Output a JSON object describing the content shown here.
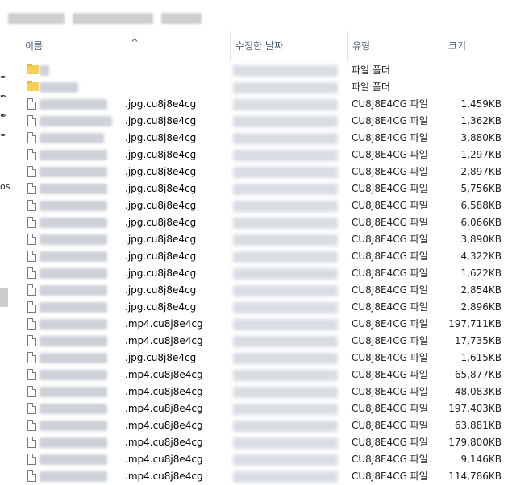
{
  "header": {
    "col_name": "이름",
    "col_date": "수정한 날짜",
    "col_type": "유형",
    "col_size": "크기",
    "sort_arrow": "^"
  },
  "nav": {
    "partial_label": "os"
  },
  "rows": [
    {
      "kind": "folder",
      "ext": "",
      "type": "파일 폴더",
      "size": ""
    },
    {
      "kind": "folder",
      "ext": "",
      "type": "파일 폴더",
      "size": ""
    },
    {
      "kind": "file",
      "ext": ".jpg.cu8j8e4cg",
      "type": "CU8J8E4CG 파일",
      "size": "1,459KB"
    },
    {
      "kind": "file",
      "ext": ".jpg.cu8j8e4cg",
      "type": "CU8J8E4CG 파일",
      "size": "1,362KB"
    },
    {
      "kind": "file",
      "ext": ".jpg.cu8j8e4cg",
      "type": "CU8J8E4CG 파일",
      "size": "3,880KB"
    },
    {
      "kind": "file",
      "ext": ".jpg.cu8j8e4cg",
      "type": "CU8J8E4CG 파일",
      "size": "1,297KB"
    },
    {
      "kind": "file",
      "ext": ".jpg.cu8j8e4cg",
      "type": "CU8J8E4CG 파일",
      "size": "2,897KB"
    },
    {
      "kind": "file",
      "ext": ".jpg.cu8j8e4cg",
      "type": "CU8J8E4CG 파일",
      "size": "5,756KB"
    },
    {
      "kind": "file",
      "ext": ".jpg.cu8j8e4cg",
      "type": "CU8J8E4CG 파일",
      "size": "6,588KB"
    },
    {
      "kind": "file",
      "ext": ".jpg.cu8j8e4cg",
      "type": "CU8J8E4CG 파일",
      "size": "6,066KB"
    },
    {
      "kind": "file",
      "ext": ".jpg.cu8j8e4cg",
      "type": "CU8J8E4CG 파일",
      "size": "3,890KB"
    },
    {
      "kind": "file",
      "ext": ".jpg.cu8j8e4cg",
      "type": "CU8J8E4CG 파일",
      "size": "4,322KB"
    },
    {
      "kind": "file",
      "ext": ".jpg.cu8j8e4cg",
      "type": "CU8J8E4CG 파일",
      "size": "1,622KB"
    },
    {
      "kind": "file",
      "ext": ".jpg.cu8j8e4cg",
      "type": "CU8J8E4CG 파일",
      "size": "2,854KB"
    },
    {
      "kind": "file",
      "ext": ".jpg.cu8j8e4cg",
      "type": "CU8J8E4CG 파일",
      "size": "2,896KB"
    },
    {
      "kind": "file",
      "ext": ".mp4.cu8j8e4cg",
      "type": "CU8J8E4CG 파일",
      "size": "197,711KB"
    },
    {
      "kind": "file",
      "ext": ".mp4.cu8j8e4cg",
      "type": "CU8J8E4CG 파일",
      "size": "17,735KB"
    },
    {
      "kind": "file",
      "ext": ".jpg.cu8j8e4cg",
      "type": "CU8J8E4CG 파일",
      "size": "1,615KB"
    },
    {
      "kind": "file",
      "ext": ".mp4.cu8j8e4cg",
      "type": "CU8J8E4CG 파일",
      "size": "65,877KB"
    },
    {
      "kind": "file",
      "ext": ".mp4.cu8j8e4cg",
      "type": "CU8J8E4CG 파일",
      "size": "48,083KB"
    },
    {
      "kind": "file",
      "ext": ".mp4.cu8j8e4cg",
      "type": "CU8J8E4CG 파일",
      "size": "197,403KB"
    },
    {
      "kind": "file",
      "ext": ".mp4.cu8j8e4cg",
      "type": "CU8J8E4CG 파일",
      "size": "63,881KB"
    },
    {
      "kind": "file",
      "ext": ".mp4.cu8j8e4cg",
      "type": "CU8J8E4CG 파일",
      "size": "179,800KB"
    },
    {
      "kind": "file",
      "ext": ".mp4.cu8j8e4cg",
      "type": "CU8J8E4CG 파일",
      "size": "9,146KB"
    },
    {
      "kind": "file",
      "ext": ".mp4.cu8j8e4cg",
      "type": "CU8J8E4CG 파일",
      "size": "114,786KB"
    }
  ]
}
